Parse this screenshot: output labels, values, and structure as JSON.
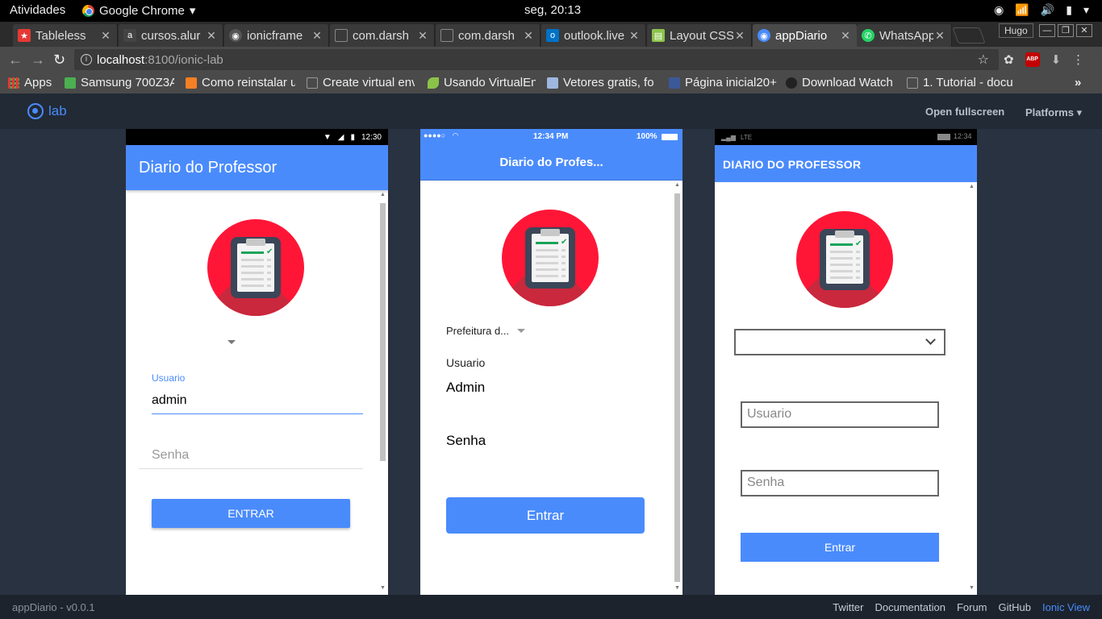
{
  "os_bar": {
    "activities": "Atividades",
    "app_name": "Google Chrome",
    "clock": "seg, 20:13"
  },
  "tabs": [
    {
      "title": "Tableless",
      "color": "#e53935",
      "icon": "star-favicon"
    },
    {
      "title": "cursos.alur",
      "color": "#444444",
      "icon": "alura-favicon"
    },
    {
      "title": "ionicframe",
      "color": "#555555",
      "icon": "ionic-favicon"
    },
    {
      "title": "com.darsh",
      "color": "#555555",
      "icon": "document-favicon"
    },
    {
      "title": "com.darsh",
      "color": "#555555",
      "icon": "document-favicon"
    },
    {
      "title": "outlook.live",
      "color": "#0072c6",
      "icon": "outlook-favicon"
    },
    {
      "title": "Layout CSS",
      "color": "#8bc34a",
      "icon": "layout-favicon"
    },
    {
      "title": "appDiario",
      "color": "#4a8bfc",
      "icon": "ionic-favicon"
    },
    {
      "title": "WhatsApp",
      "color": "#25d366",
      "icon": "whatsapp-favicon"
    }
  ],
  "profile_name": "Hugo",
  "address": {
    "host": "localhost",
    "path": ":8100/ionic-lab"
  },
  "bookmarks": [
    {
      "label": "Apps",
      "color": "#e0a030"
    },
    {
      "label": "Samsung 700Z3A",
      "color": "#4caf50"
    },
    {
      "label": "Como reinstalar u",
      "color": "#f48024"
    },
    {
      "label": "Create virtual env",
      "color": "#888888"
    },
    {
      "label": "Usando VirtualEnv",
      "color": "#8bc34a"
    },
    {
      "label": "Vetores gratis, fo",
      "color": "#9fb7e0"
    },
    {
      "label": "Página inicial20+",
      "color": "#3b5998"
    },
    {
      "label": "Download Watch",
      "color": "#222222"
    },
    {
      "label": "1. Tutorial - docu",
      "color": "#888888"
    }
  ],
  "lab": {
    "logo_text": "lab",
    "open_fullscreen": "Open fullscreen",
    "platforms": "Platforms",
    "version": "appDiario - v0.0.1",
    "footer_links": [
      "Twitter",
      "Documentation",
      "Forum",
      "GitHub",
      "Ionic View"
    ]
  },
  "android": {
    "status_time": "12:30",
    "title": "Diario do Professor",
    "user_label": "Usuario",
    "user_value": "admin",
    "password_placeholder": "Senha",
    "button": "ENTRAR"
  },
  "ios": {
    "status_time": "12:34 PM",
    "battery": "100%",
    "title": "Diario do Profes...",
    "select_value": "Prefeitura d...",
    "user_label": "Usuario",
    "user_value": "Admin",
    "password_placeholder": "Senha",
    "button": "Entrar"
  },
  "windows": {
    "status_network": "LTE",
    "status_time": "12:34",
    "title": "DIARIO DO PROFESSOR",
    "user_placeholder": "Usuario",
    "password_placeholder": "Senha",
    "button": "Entrar"
  },
  "colors": {
    "ionic_primary": "#4a8bfc",
    "avatar_red": "#ff1637",
    "lab_bg": "#293241"
  }
}
